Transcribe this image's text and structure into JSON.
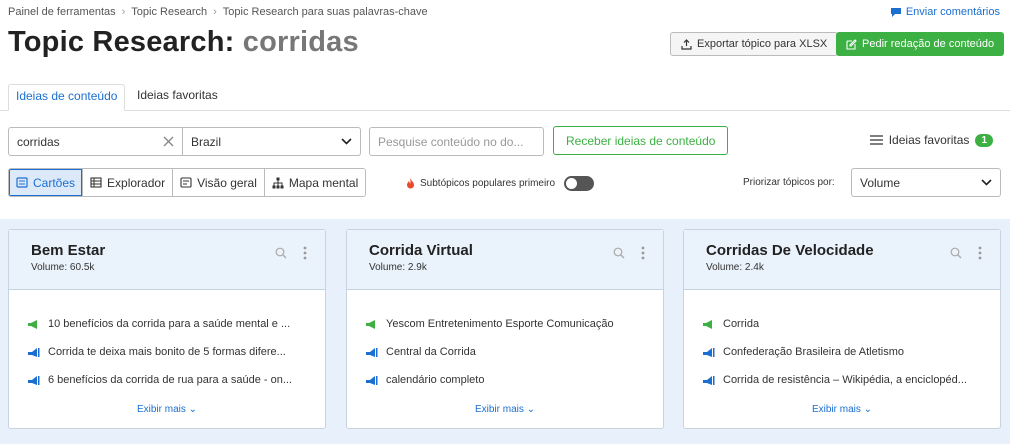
{
  "breadcrumb": [
    "Painel de ferramentas",
    "Topic Research",
    "Topic Research para suas palavras-chave"
  ],
  "feedback_label": "Enviar comentários",
  "title": {
    "prefix": "Topic Research:",
    "keyword": "corridas"
  },
  "buttons": {
    "export": "Exportar tópico para XLSX",
    "order": "Pedir redação de conteúdo"
  },
  "tabs": [
    "Ideias de conteúdo",
    "Ideias favoritas"
  ],
  "search": {
    "keyword_value": "corridas",
    "country_value": "Brazil",
    "content_placeholder": "Pesquise conteúdo no do...",
    "get_ideas_label": "Receber ideias de conteúdo"
  },
  "favorites": {
    "label": "Ideias favoritas",
    "count": "1"
  },
  "views": [
    "Cartões",
    "Explorador",
    "Visão geral",
    "Mapa mental"
  ],
  "popular_label": "Subtópicos populares primeiro",
  "prioritize": {
    "label": "Priorizar tópicos por:",
    "value": "Volume"
  },
  "show_more_label": "Exibir mais",
  "colors": {
    "accent": "#1a6fd0",
    "green": "#3cb043",
    "card_bg": "#e8f1fb"
  },
  "cards": [
    {
      "title": "Bem Estar",
      "volume": "Volume: 60.5k",
      "items": [
        {
          "icon": "megaphone-icon",
          "text": "10 benefícios da corrida para a saúde mental e ..."
        },
        {
          "icon": "question-icon",
          "text": "Corrida te deixa mais bonito de 5 formas difere..."
        },
        {
          "icon": "question-icon",
          "text": "6 benefícios da corrida de rua para a saúde - on..."
        }
      ]
    },
    {
      "title": "Corrida Virtual",
      "volume": "Volume: 2.9k",
      "items": [
        {
          "icon": "megaphone-icon",
          "text": "Yescom Entretenimento Esporte Comunicação"
        },
        {
          "icon": "question-icon",
          "text": "Central da Corrida"
        },
        {
          "icon": "question-icon",
          "text": "calendário completo"
        }
      ]
    },
    {
      "title": "Corridas De Velocidade",
      "volume": "Volume: 2.4k",
      "items": [
        {
          "icon": "megaphone-icon",
          "text": "Corrida"
        },
        {
          "icon": "question-icon",
          "text": "Confederação Brasileira de Atletismo"
        },
        {
          "icon": "question-icon",
          "text": "Corrida de resistência – Wikipédia, a enciclopéd..."
        }
      ]
    }
  ]
}
